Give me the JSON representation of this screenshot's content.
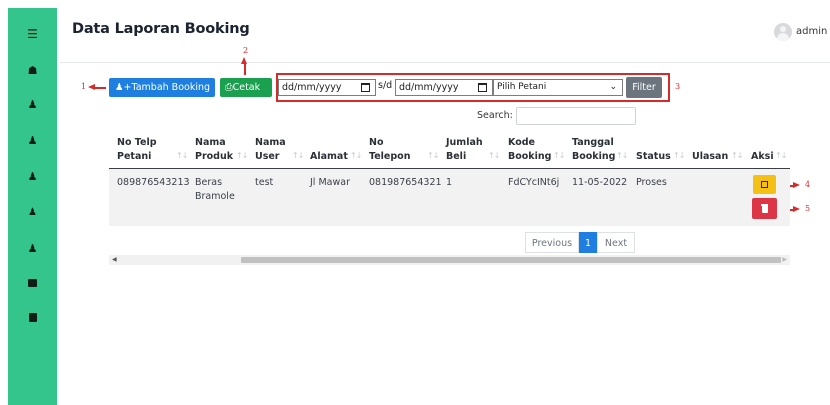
{
  "sidebar": {
    "items": [
      {
        "icon": "menu-icon"
      },
      {
        "icon": "home-icon"
      },
      {
        "icon": "user-icon"
      },
      {
        "icon": "user-icon"
      },
      {
        "icon": "user-icon"
      },
      {
        "icon": "users-icon"
      },
      {
        "icon": "user-icon"
      },
      {
        "icon": "folder-icon"
      },
      {
        "icon": "book-icon"
      }
    ],
    "color": "#33c58b"
  },
  "header": {
    "title": "Data Laporan Booking",
    "user": "admin"
  },
  "toolbar": {
    "add_label": "Tambah Booking",
    "print_label": "Cetak",
    "date_from_placeholder": "dd/mm/yyyy",
    "range_separator": "s/d",
    "date_to_placeholder": "dd/mm/yyyy",
    "petani_select_value": "Pilih Petani",
    "filter_label": "Filter"
  },
  "annotations": {
    "n1": "1",
    "n2": "2",
    "n3": "3",
    "n4": "4",
    "n5": "5"
  },
  "search": {
    "label": "Search:"
  },
  "table": {
    "headers": [
      [
        "No Telp",
        "Petani"
      ],
      [
        "Nama",
        "Produk"
      ],
      [
        "Nama",
        "User"
      ],
      [
        "Alamat"
      ],
      [
        "No",
        "Telepon"
      ],
      [
        "Jumlah",
        "Beli"
      ],
      [
        "Kode",
        "Booking"
      ],
      [
        "Tanggal",
        "Booking"
      ],
      [
        "Status"
      ],
      [
        "Ulasan"
      ],
      [
        "Aksi"
      ]
    ],
    "rows": [
      {
        "no_telp_petani": "089876543213",
        "nama_produk_1": "Beras",
        "nama_produk_2": "Bramole",
        "nama_user": "test",
        "alamat": "Jl Mawar",
        "no_telepon": "081987654321",
        "jumlah_beli": "1",
        "kode_booking": "FdCYcINt6j",
        "tanggal_booking": "11-05-2022",
        "status": "Proses",
        "ulasan": ""
      }
    ]
  },
  "pagination": {
    "previous": "Previous",
    "current": "1",
    "next": "Next"
  },
  "colors": {
    "primary": "#1e7fe0",
    "success": "#1aa04e",
    "secondary": "#6c757d",
    "warning": "#f5c015",
    "danger": "#dc3545",
    "annotation": "#d62b2b"
  }
}
